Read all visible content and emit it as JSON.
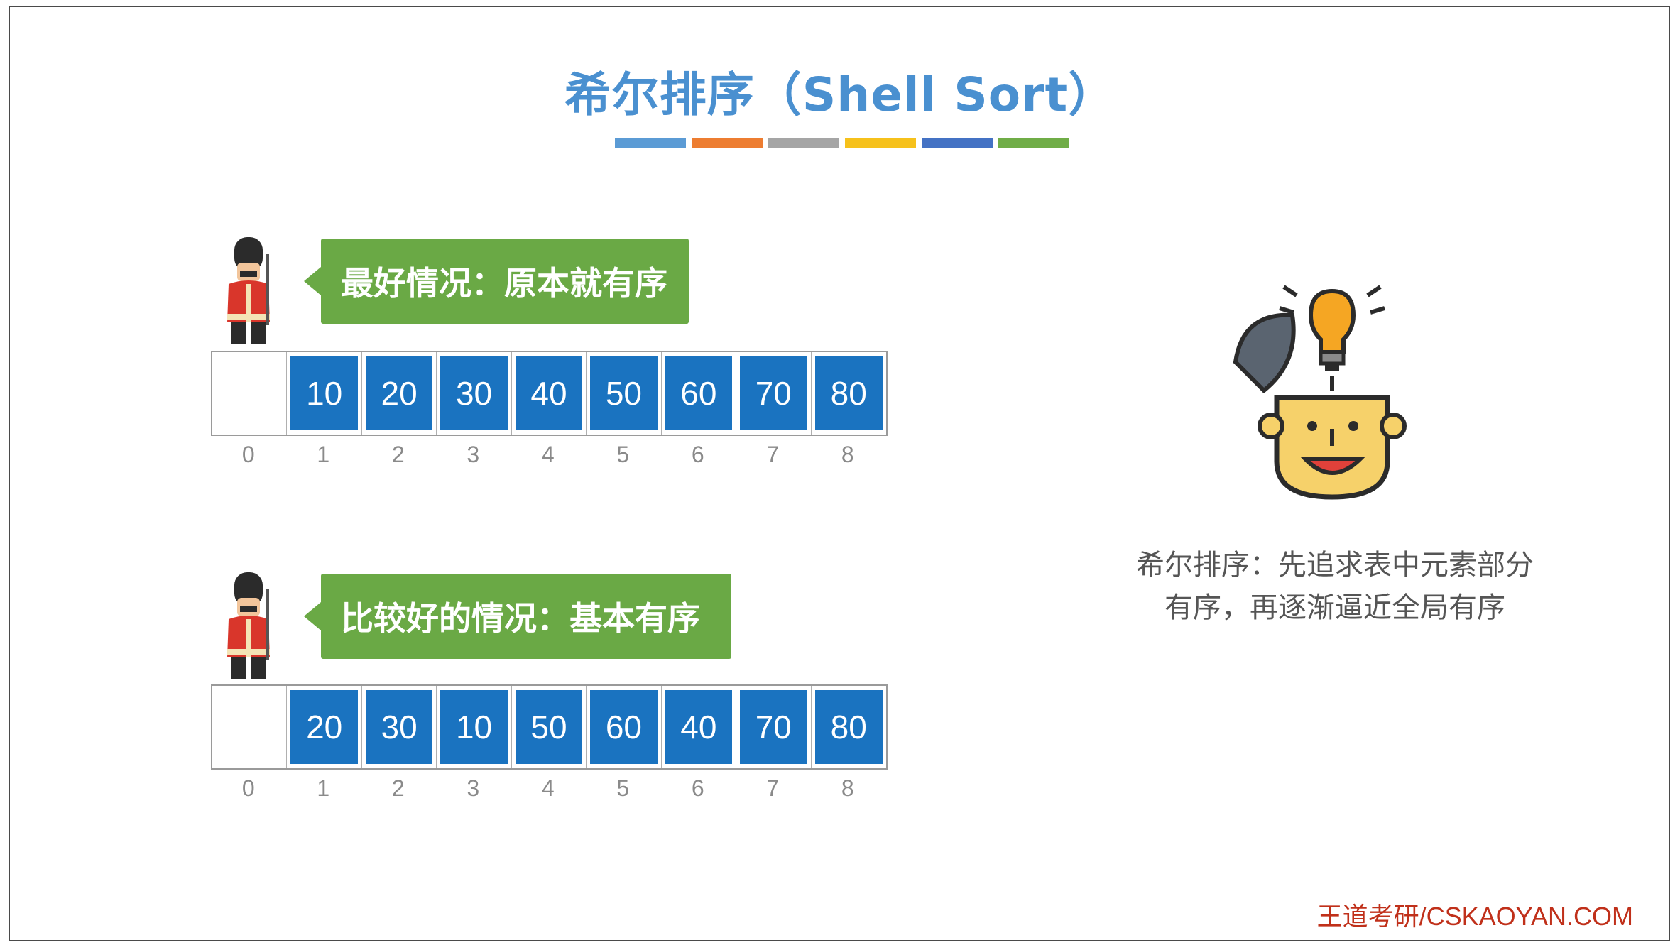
{
  "title": "希尔排序（Shell Sort）",
  "title_stripes": [
    "#5b9bd5",
    "#ed7d31",
    "#a5a5a5",
    "#f6c11b",
    "#4472c4",
    "#70ad47"
  ],
  "examples": [
    {
      "label": "最好情况：原本就有序",
      "cells": [
        "",
        "10",
        "20",
        "30",
        "40",
        "50",
        "60",
        "70",
        "80"
      ],
      "indices": [
        "0",
        "1",
        "2",
        "3",
        "4",
        "5",
        "6",
        "7",
        "8"
      ]
    },
    {
      "label": "比较好的情况：基本有序",
      "cells": [
        "",
        "20",
        "30",
        "10",
        "50",
        "60",
        "40",
        "70",
        "80"
      ],
      "indices": [
        "0",
        "1",
        "2",
        "3",
        "4",
        "5",
        "6",
        "7",
        "8"
      ]
    }
  ],
  "description": {
    "line1": "希尔排序：先追求表中元素部分",
    "line2": "有序，再逐渐逼近全局有序"
  },
  "footer": "王道考研/CSKAOYAN.COM",
  "icons": {
    "soldier": "guard-soldier-icon",
    "idea": "lightbulb-head-icon"
  },
  "colors": {
    "title": "#4a90d0",
    "bubble": "#6aa945",
    "cell": "#1a73c0",
    "footer": "#c0301a"
  }
}
